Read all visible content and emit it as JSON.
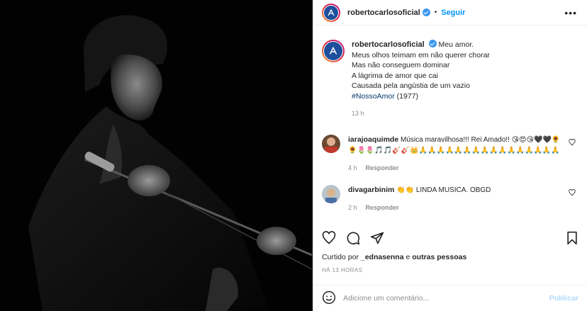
{
  "post": {
    "username": "robertocarlosoficial",
    "separator": "•",
    "follow_label": "Seguir",
    "more_label": "•••",
    "caption_lines": [
      "Meu amor.",
      "Meus olhos teimam em não querer chorar",
      "Mas não conseguem dominar",
      "A lágrima de amor que cai",
      "Causada pela angústia de um vazio"
    ],
    "hashtag": "#NossoAmor",
    "hashtag_suffix": " (1977)",
    "caption_time": "13 h"
  },
  "comments": [
    {
      "username": "iarajoaquimde",
      "text": "Música maravilhosa!!! Rei Amado!! 😘😍😘🖤🖤🌻🌻🌷🌷🎵🎵🎸🎸👑🙏🙏🙏🙏🙏🙏🙏🙏🙏🙏🙏🙏🙏🙏🙏🙏",
      "time": "4 h",
      "reply_label": "Responder"
    },
    {
      "username": "divagarbinim",
      "text": "👏👏 LINDA MUSICA. OBGD",
      "time": "2 h",
      "reply_label": "Responder"
    }
  ],
  "footer": {
    "liked_prefix": "Curtido por ",
    "liked_user": "_ednasenna",
    "liked_middle": " e ",
    "liked_others": "outras pessoas",
    "timestamp": "HÁ 13 HORAS",
    "comment_placeholder": "Adicione um comentário...",
    "publish_label": "Publicar"
  },
  "colors": {
    "accent": "#0095f6",
    "verified": "#3897f0",
    "muted": "#8e8e8e",
    "hashtag": "#00376b"
  }
}
